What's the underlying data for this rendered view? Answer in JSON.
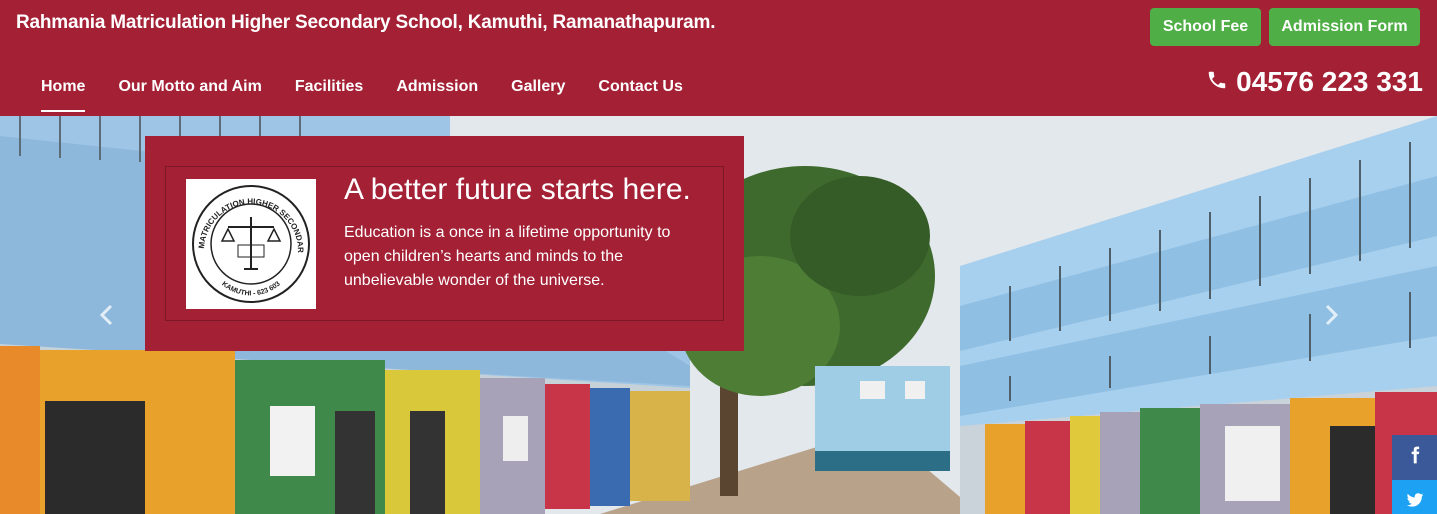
{
  "header": {
    "school_name": "Rahmania Matriculation Higher Secondary School, Kamuthi, Ramanathapuram.",
    "buttons": {
      "fee_label": "School Fee",
      "admission_label": "Admission Form"
    },
    "phone": "04576 223 331",
    "phone_icon": "phone-icon"
  },
  "nav": {
    "items": [
      {
        "label": "Home",
        "active": true
      },
      {
        "label": "Our Motto and Aim"
      },
      {
        "label": "Facilities"
      },
      {
        "label": "Admission"
      },
      {
        "label": "Gallery"
      },
      {
        "label": "Contact Us"
      }
    ]
  },
  "hero": {
    "caption": {
      "title": "A better future starts here.",
      "text": "Education is a once in a lifetime opportunity to open children’s hearts and minds to the unbelievable wonder of the universe."
    },
    "logo": {
      "top_text": "RAHMANIA MATRICULATION HIGHER SECONDARY SCHOOL",
      "bottom_text": "KAMUTHI - 623 603"
    },
    "controls": {
      "prev_icon": "chevron-left-icon",
      "next_icon": "chevron-right-icon"
    }
  },
  "social": {
    "facebook_icon": "facebook-icon",
    "twitter_icon": "twitter-icon"
  },
  "colors": {
    "brand": "#a32035",
    "button_green": "#4fae46",
    "facebook": "#3b5998",
    "twitter": "#1da1f2"
  }
}
